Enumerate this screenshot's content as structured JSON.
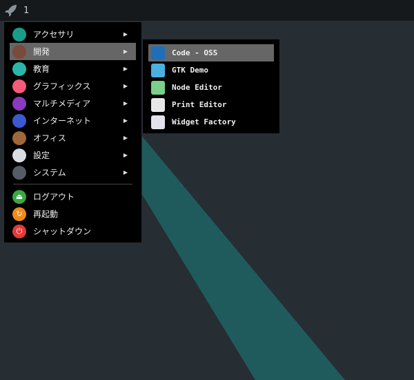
{
  "topbar": {
    "workspace": "1"
  },
  "menu": {
    "items": [
      {
        "label": "アクセサリ",
        "icon": "accessories-icon",
        "color": "#1a9c8c",
        "submenu": true
      },
      {
        "label": "開発",
        "icon": "development-hammer-icon",
        "color": "#7a4a3a",
        "submenu": true,
        "active": true
      },
      {
        "label": "教育",
        "icon": "education-atom-icon",
        "color": "#2bb5a8",
        "submenu": true
      },
      {
        "label": "グラフィックス",
        "icon": "graphics-icon",
        "color": "#f45a7a",
        "submenu": true
      },
      {
        "label": "マルチメディア",
        "icon": "multimedia-icon",
        "color": "#8a3ac0",
        "submenu": true
      },
      {
        "label": "インターネット",
        "icon": "internet-icon",
        "color": "#3a5ad0",
        "submenu": true
      },
      {
        "label": "オフィス",
        "icon": "office-briefcase-icon",
        "color": "#a0683a",
        "submenu": true
      },
      {
        "label": "設定",
        "icon": "settings-icon",
        "color": "#d8dde3",
        "submenu": true
      },
      {
        "label": "システム",
        "icon": "system-gear-icon",
        "color": "#555c66",
        "submenu": true
      }
    ],
    "actions": [
      {
        "label": "ログアウト",
        "icon": "logout-icon",
        "color": "#3aa845",
        "glyph": "⏏"
      },
      {
        "label": "再起動",
        "icon": "restart-icon",
        "color": "#f08a1a",
        "glyph": "↻"
      },
      {
        "label": "シャットダウン",
        "icon": "shutdown-icon",
        "color": "#e23a3a",
        "glyph": "⏻"
      }
    ],
    "arrow": "▶"
  },
  "submenu": {
    "items": [
      {
        "label": "Code - OSS",
        "icon": "vscode-icon",
        "color": "#1e6fb8",
        "active": true
      },
      {
        "label": "GTK Demo",
        "icon": "gtk-cube-icon",
        "color": "#4ab0e0"
      },
      {
        "label": "Node Editor",
        "icon": "node-editor-icon",
        "color": "#7ad08a"
      },
      {
        "label": "Print Editor",
        "icon": "print-editor-icon",
        "color": "#e8e8e8"
      },
      {
        "label": "Widget Factory",
        "icon": "widget-factory-icon",
        "color": "#e0e4ea"
      }
    ]
  }
}
